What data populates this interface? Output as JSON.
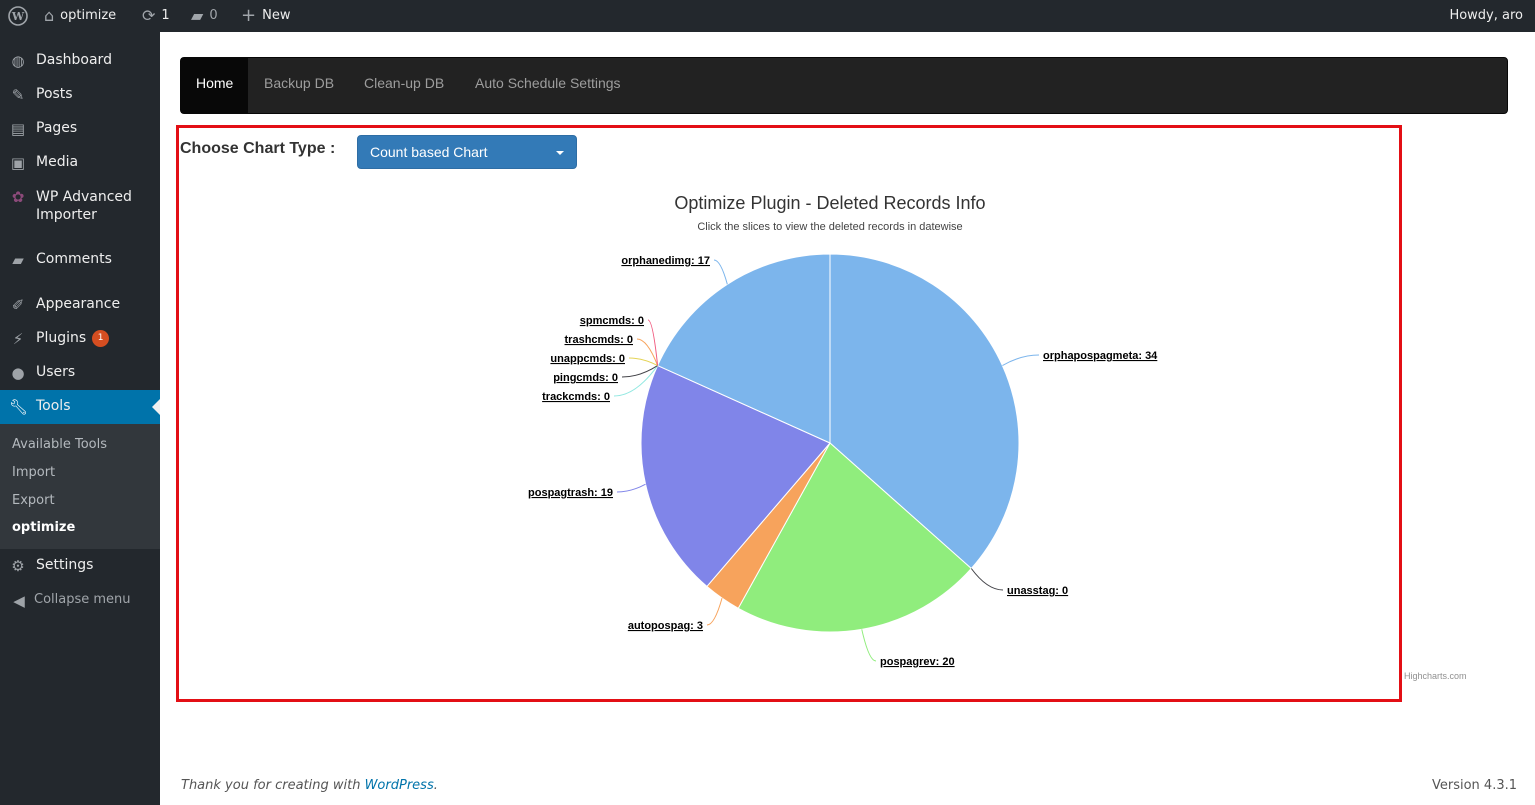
{
  "adminbar": {
    "site_name": "optimize",
    "updates_count": "1",
    "comments_count": "0",
    "new_label": "New",
    "greeting": "Howdy, aro"
  },
  "sidebar": {
    "items": [
      {
        "label": "Dashboard",
        "icon": "dashboard-icon"
      },
      {
        "label": "Posts",
        "icon": "pin-icon"
      },
      {
        "label": "Pages",
        "icon": "pages-icon"
      },
      {
        "label": "Media",
        "icon": "media-icon"
      },
      {
        "label": "WP Advanced Importer",
        "icon": "importer-icon"
      },
      {
        "label": "Comments",
        "icon": "comment-icon"
      },
      {
        "label": "Appearance",
        "icon": "brush-icon"
      },
      {
        "label": "Plugins",
        "icon": "plugin-icon",
        "badge": "1"
      },
      {
        "label": "Users",
        "icon": "user-icon"
      },
      {
        "label": "Tools",
        "icon": "wrench-icon",
        "current": true
      },
      {
        "label": "Settings",
        "icon": "settings-icon"
      },
      {
        "label": "Collapse menu",
        "icon": "collapse-icon"
      }
    ],
    "submenu": [
      "Available Tools",
      "Import",
      "Export",
      "optimize"
    ],
    "importer_label_line1": "WP Advanced",
    "importer_label_line2": "Importer"
  },
  "navbar": {
    "tabs": [
      "Home",
      "Backup DB",
      "Clean-up DB",
      "Auto Schedule Settings"
    ],
    "active": "Home"
  },
  "chart_controls": {
    "label": "Choose Chart Type  :",
    "selected": "Count based Chart"
  },
  "chart_data": {
    "type": "pie",
    "title": "Optimize Plugin - Deleted Records Info",
    "subtitle": "Click the slices to view the deleted records in datewise",
    "credits": "Highcharts.com",
    "slices": [
      {
        "name": "orphapospagmeta",
        "value": 34,
        "color": "#7cb5ec"
      },
      {
        "name": "unasstag",
        "value": 0,
        "color": "#434348"
      },
      {
        "name": "pospagrev",
        "value": 20,
        "color": "#90ed7d"
      },
      {
        "name": "autopospag",
        "value": 3,
        "color": "#f7a35c"
      },
      {
        "name": "pospagtrash",
        "value": 19,
        "color": "#8085e9"
      },
      {
        "name": "trackcmds",
        "value": 0,
        "color": "#91e8e1"
      },
      {
        "name": "pingcmds",
        "value": 0,
        "color": "#434348"
      },
      {
        "name": "unappcmds",
        "value": 0,
        "color": "#e4d354"
      },
      {
        "name": "trashcmds",
        "value": 0,
        "color": "#f7a35c"
      },
      {
        "name": "spmcmds",
        "value": 0,
        "color": "#f15c80"
      },
      {
        "name": "orphanedimg",
        "value": 17,
        "color": "#7cb5ec"
      }
    ]
  },
  "footer": {
    "thanks_prefix": "Thank you for creating with ",
    "thanks_link": "WordPress",
    "thanks_suffix": ".",
    "version": "Version 4.3.1"
  }
}
